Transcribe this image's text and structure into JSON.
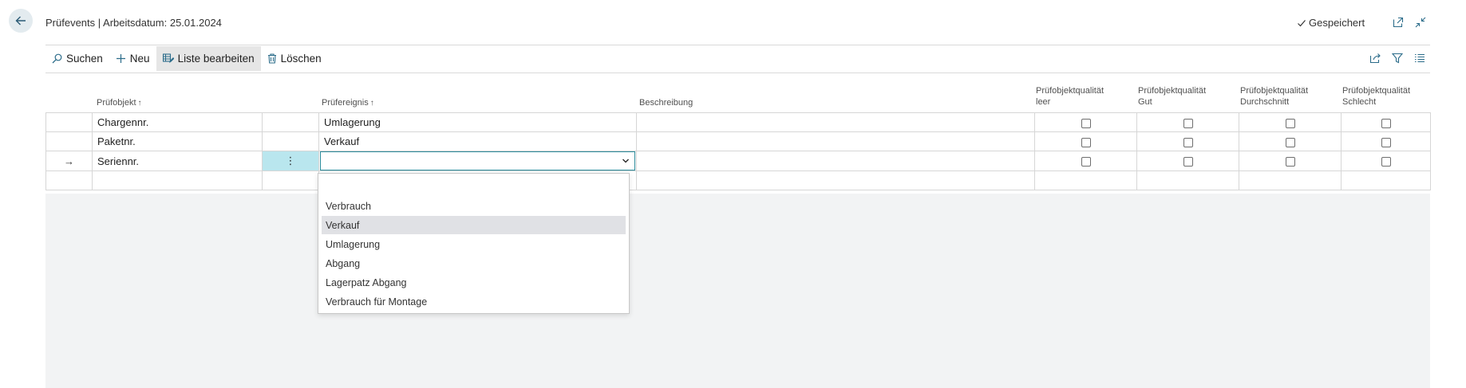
{
  "header": {
    "title": "Prüfevents | Arbeitsdatum: 25.01.2024",
    "saved_label": "Gespeichert",
    "icons": [
      "back-arrow-icon",
      "checkmark-icon",
      "open-in-new-window-icon",
      "collapse-icon"
    ]
  },
  "toolbar": {
    "search_label": "Suchen",
    "new_label": "Neu",
    "edit_list_label": "Liste bearbeiten",
    "delete_label": "Löschen",
    "right_icons": [
      "share-icon",
      "filter-icon",
      "list-view-icon"
    ]
  },
  "columns": {
    "pruefobjekt": "Prüfobjekt",
    "pruefereignis": "Prüfereignis",
    "beschreibung": "Beschreibung",
    "q_leer_1": "Prüfobjektqualität",
    "q_leer_2": "leer",
    "q_gut_1": "Prüfobjektqualität",
    "q_gut_2": "Gut",
    "q_durch_1": "Prüfobjektqualität",
    "q_durch_2": "Durchschnitt",
    "q_schlecht_1": "Prüfobjektqualität",
    "q_schlecht_2": "Schlecht",
    "sort_indicator": "↑"
  },
  "rows": [
    {
      "pruefobjekt": "Chargennr.",
      "pruefereignis": "Umlagerung",
      "beschreibung": "",
      "q_leer": false,
      "q_gut": false,
      "q_durchschnitt": false,
      "q_schlecht": false
    },
    {
      "pruefobjekt": "Paketnr.",
      "pruefereignis": "Verkauf",
      "beschreibung": "",
      "q_leer": false,
      "q_gut": false,
      "q_durchschnitt": false,
      "q_schlecht": false
    },
    {
      "pruefobjekt": "Seriennr.",
      "pruefereignis": "",
      "beschreibung": "",
      "q_leer": false,
      "q_gut": false,
      "q_durchschnitt": false,
      "q_schlecht": false,
      "current": true
    }
  ],
  "row_marker": "→",
  "row_menu": "⋮",
  "dropdown": {
    "options": [
      "",
      "Verbrauch",
      "Verkauf",
      "Umlagerung",
      "Abgang",
      "Lagerpatz Abgang",
      "Verbrauch für Montage"
    ],
    "highlighted": "Verkauf"
  },
  "colors": {
    "accent": "#2b8a9a",
    "row_menu_bg": "#b9e6ee",
    "grid_bg": "#f2f3f4"
  }
}
